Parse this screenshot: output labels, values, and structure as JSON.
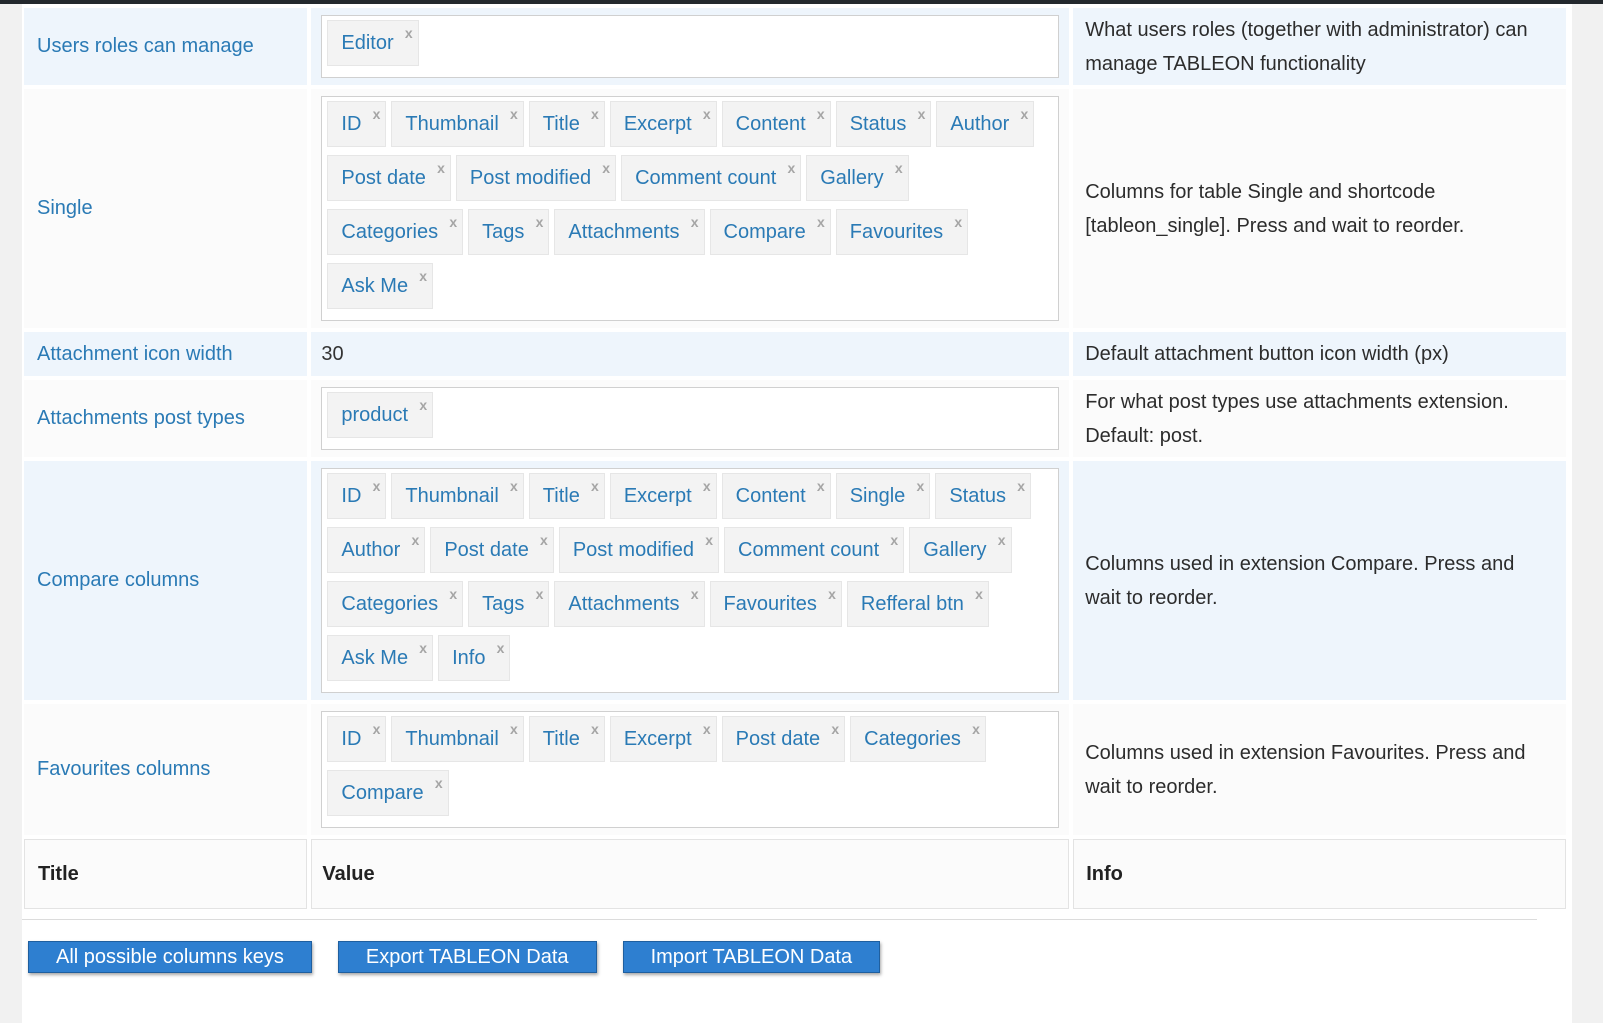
{
  "rows": [
    {
      "title": "Users roles can manage",
      "tags": [
        "Editor"
      ],
      "info": "What users roles (together with administrator) can manage TABLEON functionality",
      "highlight": true
    },
    {
      "title": "Single",
      "tags": [
        "ID",
        "Thumbnail",
        "Title",
        "Excerpt",
        "Content",
        "Status",
        "Author",
        "Post date",
        "Post modified",
        "Comment count",
        "Gallery",
        "Categories",
        "Tags",
        "Attachments",
        "Compare",
        "Favourites",
        "Ask Me"
      ],
      "info": "Columns for table Single and shortcode [tableon_single]. Press and wait to reorder.",
      "highlight": false
    },
    {
      "title": "Attachment icon width",
      "value": "30",
      "info": "Default attachment button icon width (px)",
      "highlight": true
    },
    {
      "title": "Attachments post types",
      "tags": [
        "product"
      ],
      "info": "For what post types use attachments extension. Default: post.",
      "highlight": false
    },
    {
      "title": "Compare columns",
      "tags": [
        "ID",
        "Thumbnail",
        "Title",
        "Excerpt",
        "Content",
        "Single",
        "Status",
        "Author",
        "Post date",
        "Post modified",
        "Comment count",
        "Gallery",
        "Categories",
        "Tags",
        "Attachments",
        "Favourites",
        "Refferal btn",
        "Ask Me",
        "Info"
      ],
      "info": "Columns used in extension Compare. Press and wait to reorder.",
      "highlight": true
    },
    {
      "title": "Favourites columns",
      "tags": [
        "ID",
        "Thumbnail",
        "Title",
        "Excerpt",
        "Post date",
        "Categories",
        "Compare"
      ],
      "info": "Columns used in extension Favourites. Press and wait to reorder.",
      "highlight": false
    }
  ],
  "header": {
    "title": "Title",
    "value": "Value",
    "info": "Info"
  },
  "remove_glyph": "x",
  "buttons": {
    "all_keys": "All possible columns keys",
    "export": "Export TABLEON Data",
    "import": "Import TABLEON Data"
  },
  "colors": {
    "accent": "#2e7fd0",
    "link": "#2a7ab5",
    "highlight_row": "#eef5fc"
  }
}
